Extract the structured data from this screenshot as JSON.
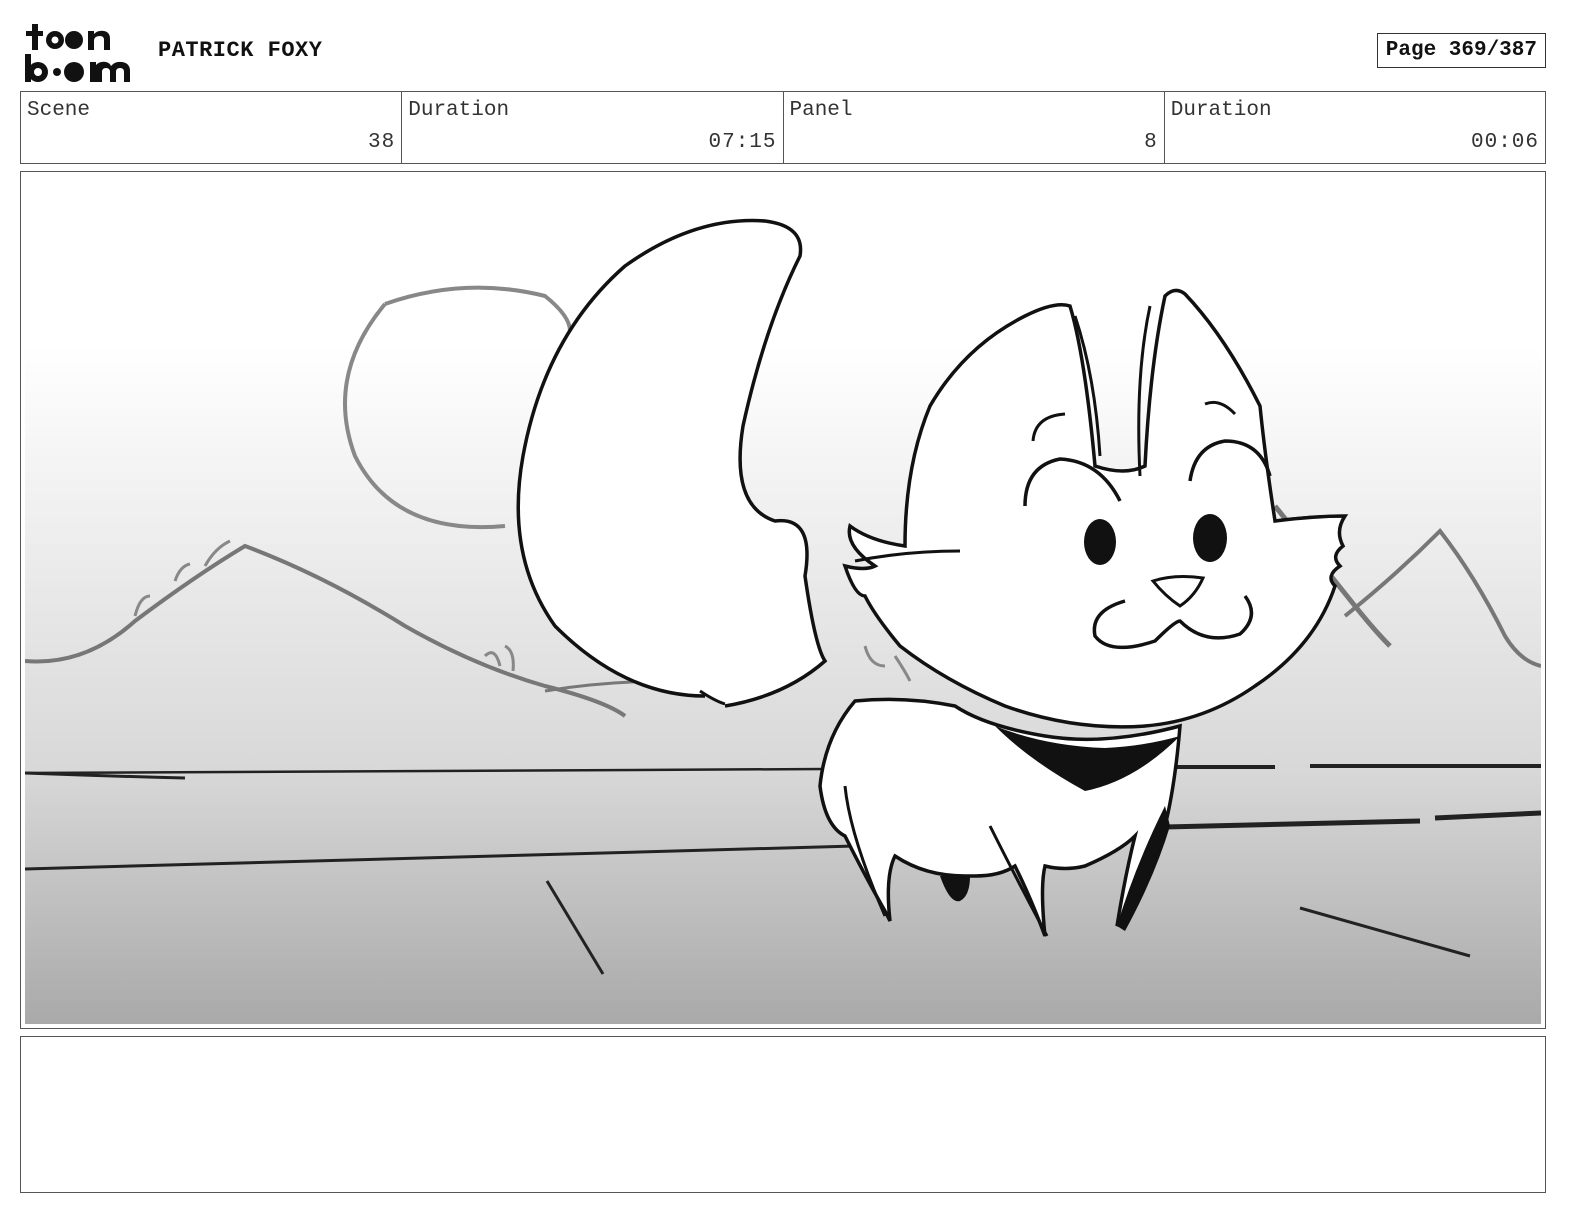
{
  "header": {
    "logo_text_top": "toon",
    "logo_text_bottom": "boom",
    "project_title": "PATRICK FOXY",
    "page_label": "Page 369/387"
  },
  "info": {
    "scene_label": "Scene",
    "scene_value": "38",
    "scene_duration_label": "Duration",
    "scene_duration_value": "07:15",
    "panel_label": "Panel",
    "panel_value": "8",
    "panel_duration_label": "Duration",
    "panel_duration_value": "00:06"
  },
  "notes": {
    "text": ""
  }
}
